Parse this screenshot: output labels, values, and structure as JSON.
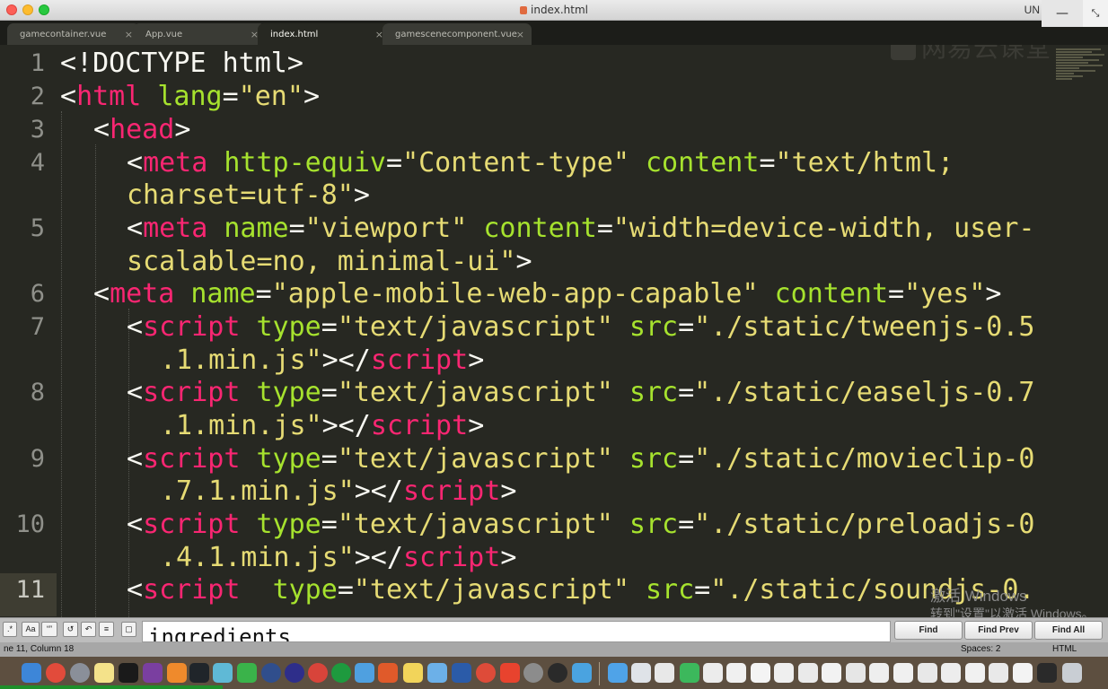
{
  "window": {
    "title": "index.html",
    "right_label": "UN"
  },
  "tabs": [
    {
      "label": "gamecontainer.vue",
      "close": "×"
    },
    {
      "label": "App.vue",
      "close": "×"
    },
    {
      "label": "index.html",
      "close": "×"
    },
    {
      "label": "gamescenecomponent.vue",
      "close": "×"
    }
  ],
  "editor": {
    "line_numbers": [
      "1",
      "2",
      "3",
      "4",
      "5",
      "6",
      "7",
      "8",
      "9",
      "10",
      "11"
    ],
    "current_line": "11",
    "watermark": "网易云课堂"
  },
  "activation_notice": {
    "line1": "激活 Windows",
    "line2": "转到\"设置\"以激活 Windows。"
  },
  "find_panel": {
    "toggle_regex": ".*",
    "toggle_case": "Aa",
    "toggle_word": "“”",
    "query": "ingredients",
    "find_label": "Find",
    "find_prev_label": "Find Prev",
    "find_all_label": "Find All"
  },
  "status_bar": {
    "position": "ne 11, Column 18",
    "indent": "Spaces: 2",
    "syntax": "HTML"
  },
  "dock_icons": [
    "finder-icon",
    "chrome-icon",
    "launchpad-icon",
    "notes-icon",
    "terminal-icon",
    "rp-icon",
    "sublime-icon",
    "activity-icon",
    "screen-icon",
    "c-icon",
    "globe-icon",
    "pinwheel-icon",
    "chrome2-icon",
    "reload-icon",
    "qt-icon",
    "folder-icon",
    "tool-icon",
    "word-icon",
    "chrome3-icon",
    "s-icon",
    "settings-icon",
    "music-icon",
    "bird-icon"
  ],
  "colors": {
    "editor_bg": "#272822",
    "tag": "#f92672",
    "attribute": "#a6e22e",
    "string": "#e6db74",
    "text": "#f8f8f2"
  }
}
